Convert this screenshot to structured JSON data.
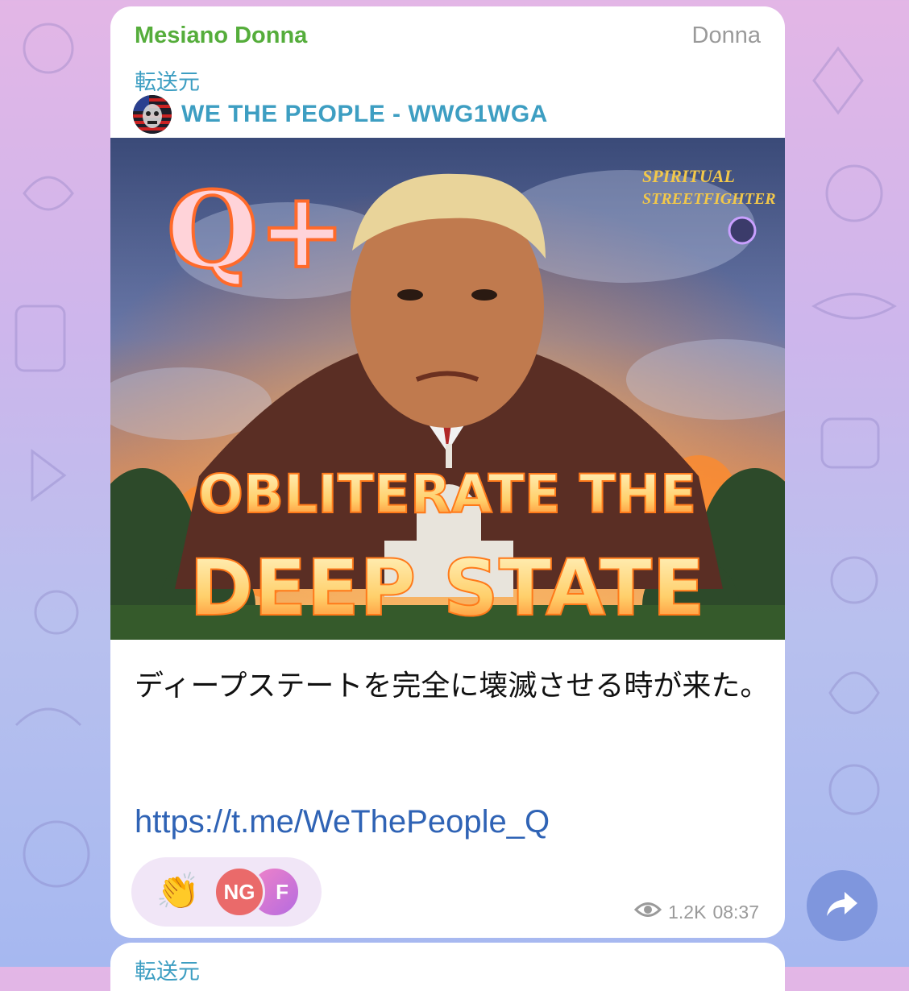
{
  "message": {
    "sender_name": "Mesiano Donna",
    "sender_tag": "Donna",
    "forwarded_label": "転送元",
    "forwarded_channel": "WE THE PEOPLE - WWG1WGA",
    "photo": {
      "text_q": "Q+",
      "text_line1": "OBLITERATE THE",
      "text_line2": "DEEP STATE",
      "watermark_line1": "SPIRITUAL",
      "watermark_line2": "STREETFIGHTER"
    },
    "text": "ディープステートを完全に壊滅させる時が来た。",
    "link": "https://t.me/WeThePeople_Q",
    "reactions": {
      "emoji": "👏",
      "avatar1": "NG",
      "avatar2": "F"
    },
    "views": "1.2K",
    "time": "08:37"
  },
  "next_message": {
    "forwarded_label": "転送元"
  },
  "icons": {
    "views": "eye-icon",
    "share": "share-arrow-icon"
  },
  "colors": {
    "sender": "#55ad3b",
    "forward": "#3d9ec2",
    "link": "#2f63b5",
    "share_button": "#7f96dd"
  }
}
